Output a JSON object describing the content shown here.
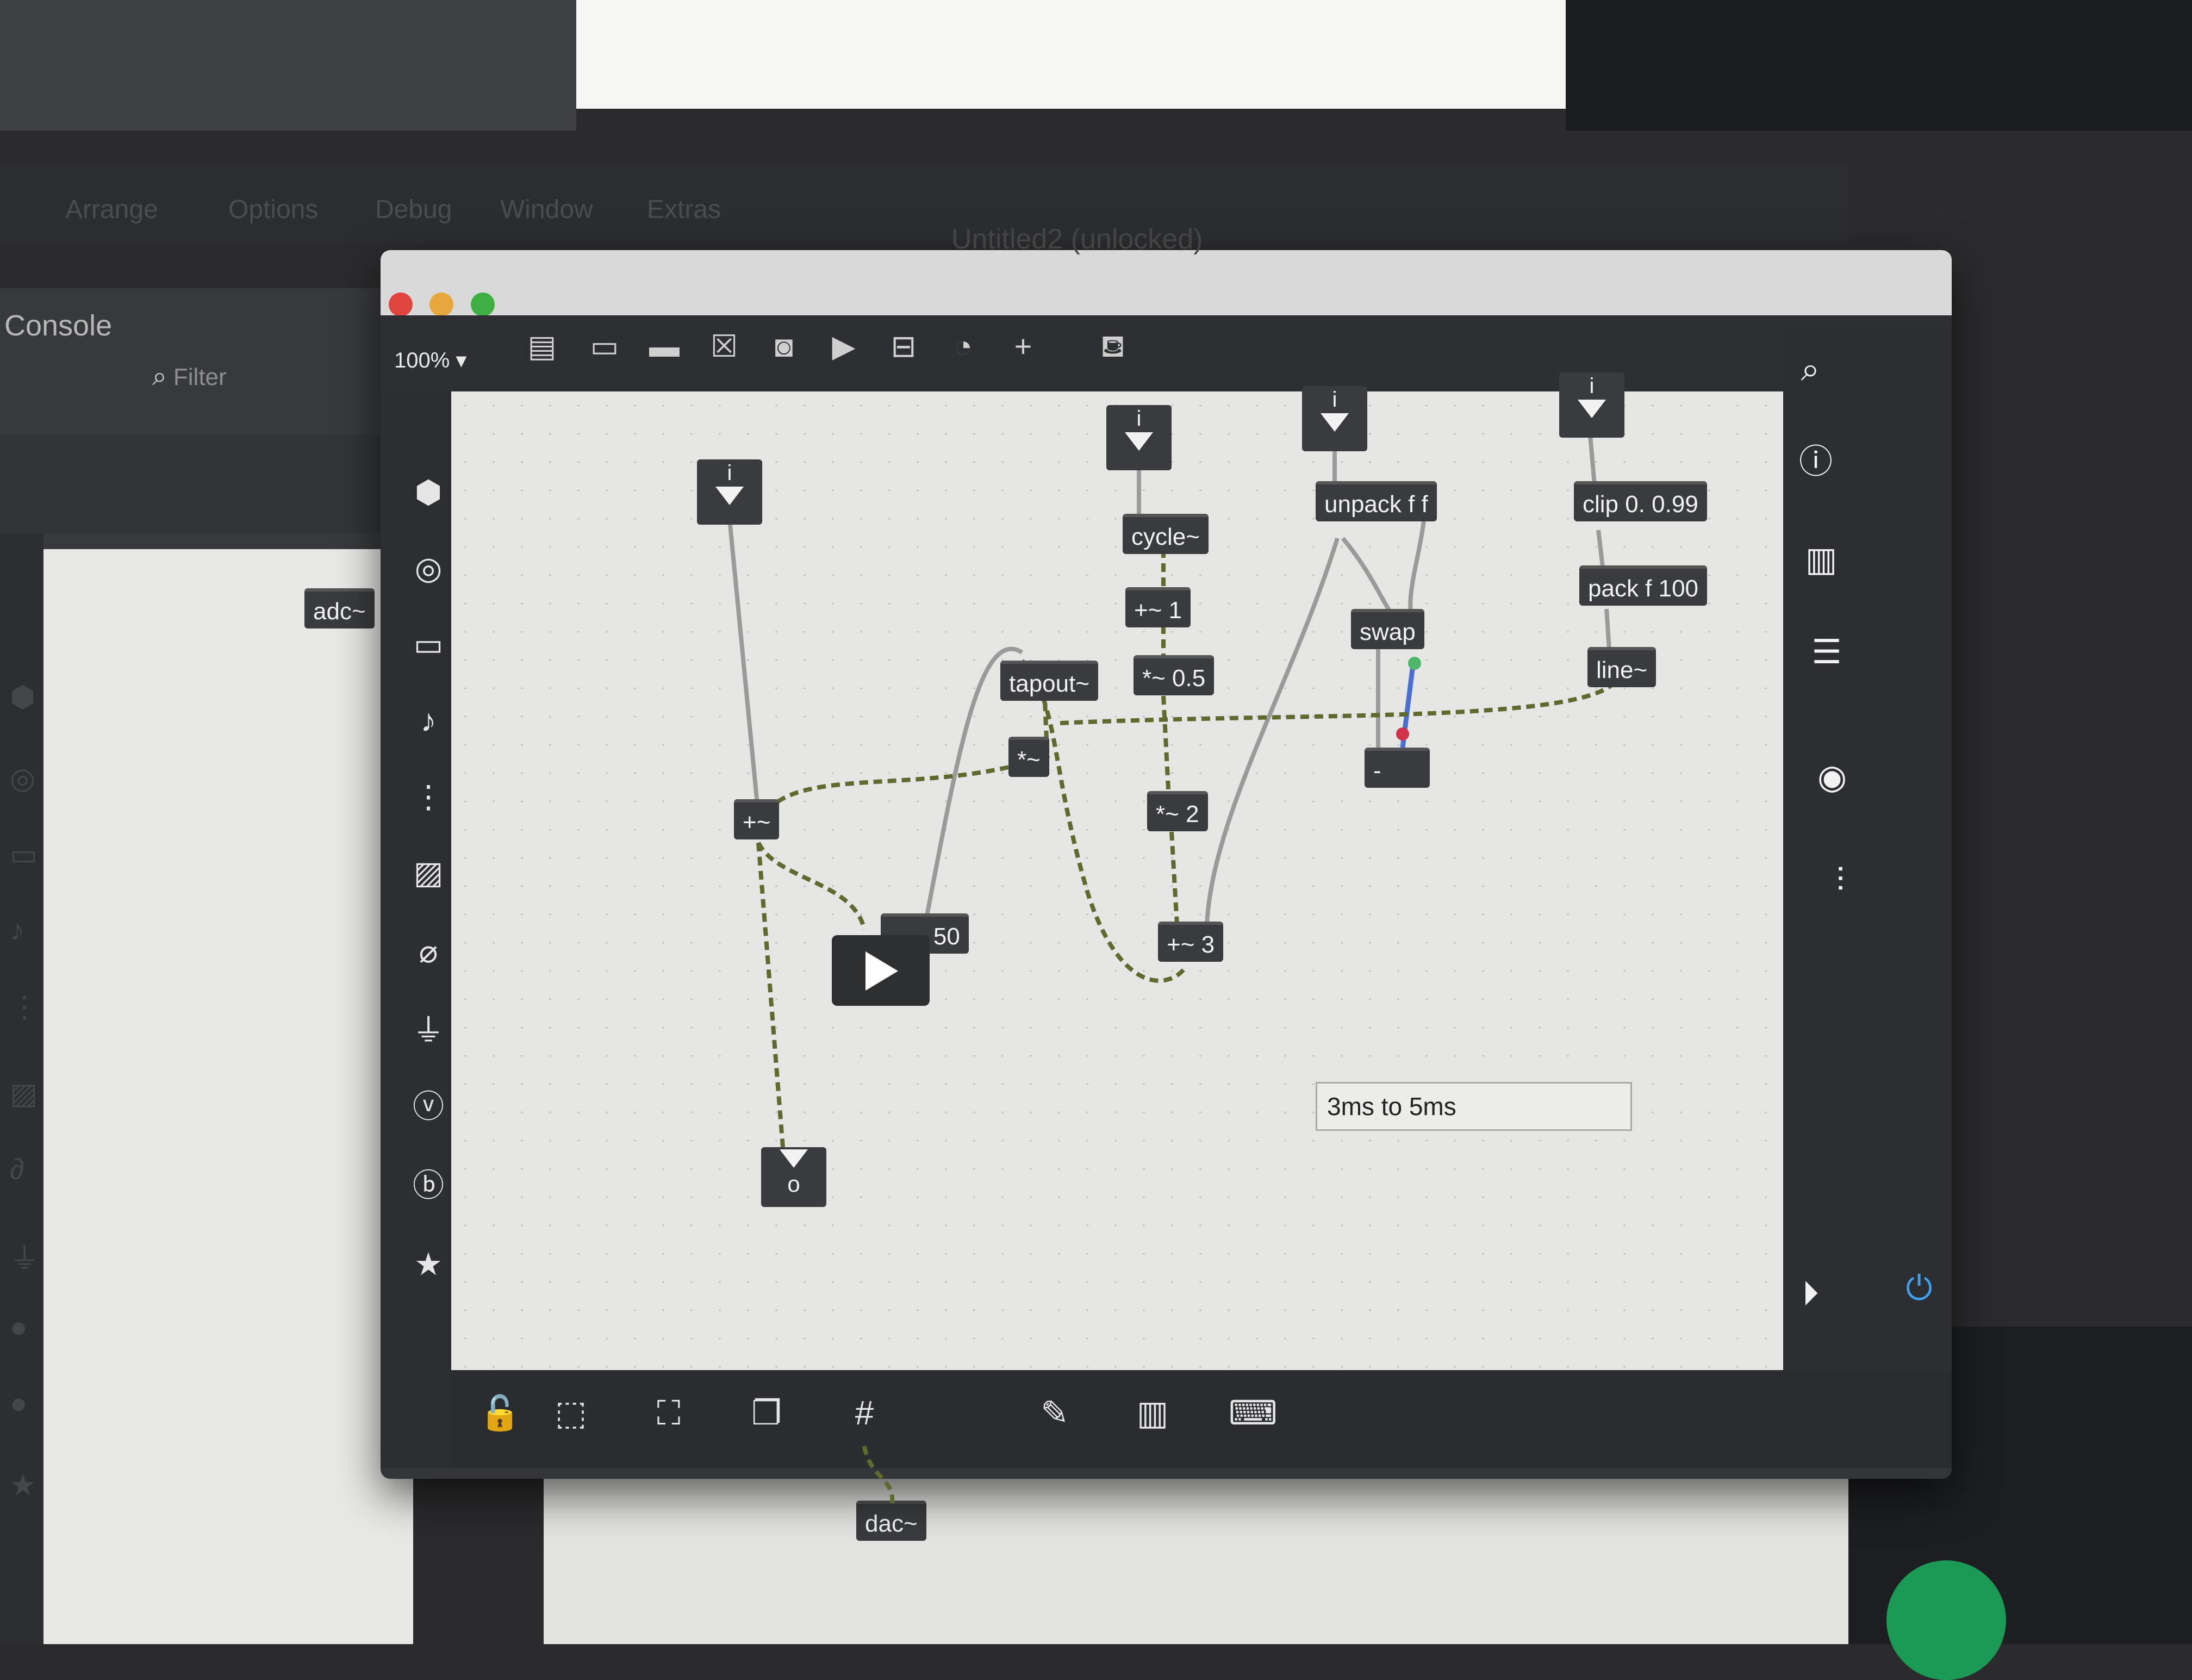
{
  "menubar": {
    "items": [
      "Arrange",
      "Options",
      "Debug",
      "Window",
      "Extras"
    ]
  },
  "console": {
    "title": "Console",
    "filter_placeholder": "Filter",
    "background_object": "adc~"
  },
  "window": {
    "title": "Untitled2 (unlocked)",
    "zoom": "100% ▾"
  },
  "toolbar": {
    "icons": [
      "presentation-icon",
      "message-icon",
      "comment-icon",
      "toggle-icon",
      "button-icon",
      "play-icon",
      "slider-icon",
      "dial-icon",
      "add-icon",
      "paint-bucket-icon"
    ]
  },
  "left_sidebar": {
    "icons": [
      "cube-icon",
      "record-icon",
      "monitor-icon",
      "music-note-icon",
      "sequence-icon",
      "image-icon",
      "paperclip-icon",
      "plug-icon",
      "vizzie-icon",
      "beap-icon",
      "star-icon"
    ]
  },
  "right_sidebar": {
    "icons": [
      "search-icon",
      "info-icon",
      "book-icon",
      "list-icon",
      "snapshot-icon",
      "mixer-icon",
      "transport-play-icon",
      "power-icon"
    ]
  },
  "bottom_bar": {
    "icons": [
      "lock-icon",
      "presentation-select-icon",
      "presentation-mode-icon",
      "windows-icon",
      "grid-icon",
      "wrench-icon",
      "piano-icon",
      "keyboard-icon"
    ]
  },
  "patch": {
    "toggle_label": "i",
    "objects": {
      "cycle": "cycle~",
      "plus1": "+~ 1",
      "times05": "*~ 0.5",
      "times2": "*~ 2",
      "plus3": "+~ 3",
      "tapout": "tapout~",
      "times": "*~",
      "plus": "+~",
      "tapin_arg": "· 50",
      "unpack": "unpack f f",
      "swap": "swap",
      "minus": "-",
      "clip": "clip 0. 0.99",
      "pack": "pack f 100",
      "line": "line~",
      "dac": "dac~"
    },
    "outlet_label": "o",
    "comment": "3ms to 5ms"
  }
}
